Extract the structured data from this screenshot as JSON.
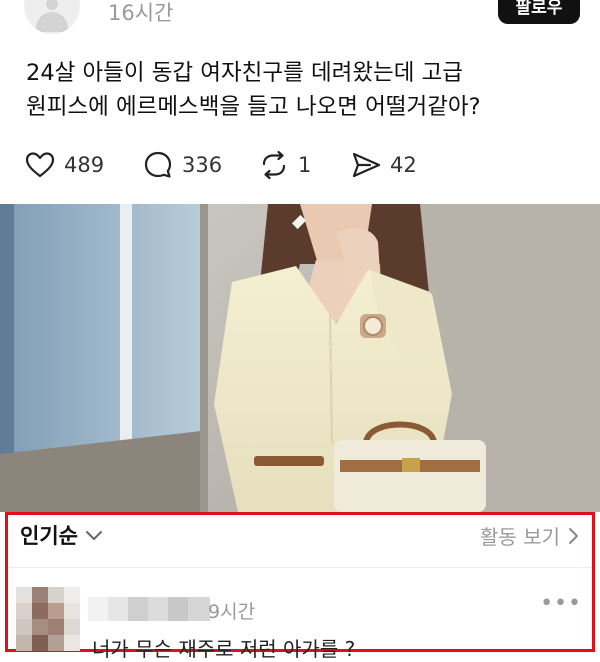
{
  "post": {
    "timestamp": "16시간",
    "follow_label": "팔로우",
    "text_lines": [
      "24살 아들이 동갑 여자친구를 데려왔는데 고급",
      "원피스에 에르메스백을 들고 나오면 어떨거같아?"
    ],
    "actions": {
      "likes": "489",
      "comments": "336",
      "reposts": "1",
      "shares": "42"
    }
  },
  "comments": {
    "sort_label": "인기순",
    "activity_link": "활동 보기",
    "first_comment": {
      "time": "9시간",
      "text": "너가 무슨 재주로 저런 아가를 ?"
    }
  },
  "colors": {
    "highlight_border": "#e0101a",
    "muted_text": "#9a9a9a"
  }
}
